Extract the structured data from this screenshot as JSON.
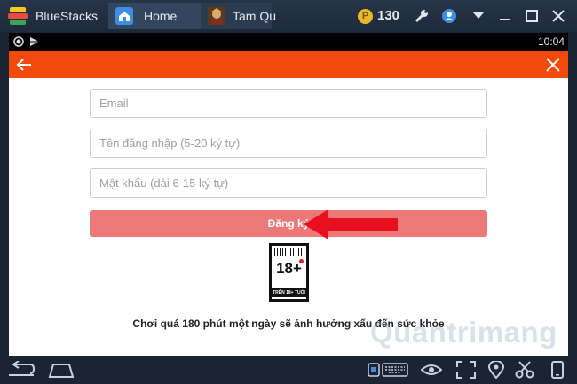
{
  "window": {
    "app_name": "BlueStacks",
    "tabs": [
      {
        "label": "Home",
        "icon": "home-icon"
      },
      {
        "label": "Tam Qu",
        "icon": "game-avatar-icon"
      }
    ],
    "coins": "130",
    "coin_symbol": "P"
  },
  "statusbar": {
    "time": "10:04"
  },
  "form": {
    "email_placeholder": "Email",
    "username_placeholder": "Tên đăng nhập (5-20 ký tự)",
    "password_placeholder": "Mật khẩu (dài 6-15 ký tự)",
    "register_label": "Đăng ký"
  },
  "age_rating": {
    "label": "18+",
    "subtext": "TRÊN 18+ TUỔI"
  },
  "warning_text": "Chơi quá 180 phút một ngày sẽ ảnh hưởng xấu đến sức khỏe",
  "watermark": "Quantrimang",
  "colors": {
    "accent": "#f24a0b",
    "button": "#ed7878",
    "chrome": "#1a2433"
  }
}
